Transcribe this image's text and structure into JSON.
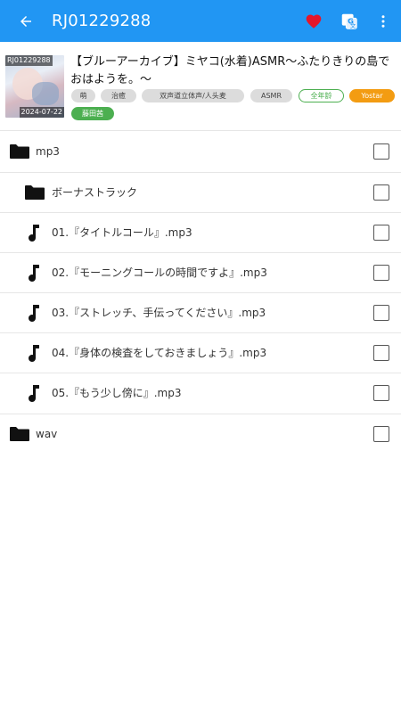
{
  "app_bar": {
    "title": "RJ01229288",
    "icons": [
      "back-arrow-icon",
      "heart-icon",
      "translate-icon",
      "more-vert-icon"
    ],
    "background_color": "#2196f3",
    "favorite_color": "#e5162a"
  },
  "work": {
    "thumbnail_code": "RJ01229288",
    "thumbnail_date": "2024-07-22",
    "title": "【ブルーアーカイブ】ミヤコ(水着)ASMR～ふたりきりの島でおはようを。～",
    "tags": [
      {
        "label": "萌",
        "style": "gray"
      },
      {
        "label": "治癒",
        "style": "gray"
      },
      {
        "label": "双声道立体声/人头麦",
        "style": "gray"
      },
      {
        "label": "ASMR",
        "style": "gray"
      },
      {
        "label": "全年龄",
        "style": "outline-green"
      },
      {
        "label": "Yostar",
        "style": "orange"
      },
      {
        "label": "藤田茜",
        "style": "green"
      }
    ]
  },
  "files": [
    {
      "type": "folder",
      "name": "mp3",
      "checked": false
    },
    {
      "type": "folder",
      "name": "ボーナストラック",
      "checked": false
    },
    {
      "type": "audio",
      "name": "01.『タイトルコール』.mp3",
      "checked": false
    },
    {
      "type": "audio",
      "name": "02.『モーニングコールの時間ですよ』.mp3",
      "checked": false
    },
    {
      "type": "audio",
      "name": "03.『ストレッチ、手伝ってください』.mp3",
      "checked": false
    },
    {
      "type": "audio",
      "name": "04.『身体の検査をしておきましょう』.mp3",
      "checked": false
    },
    {
      "type": "audio",
      "name": "05.『もう少し傍に』.mp3",
      "checked": false
    },
    {
      "type": "folder",
      "name": "wav",
      "checked": false
    }
  ]
}
